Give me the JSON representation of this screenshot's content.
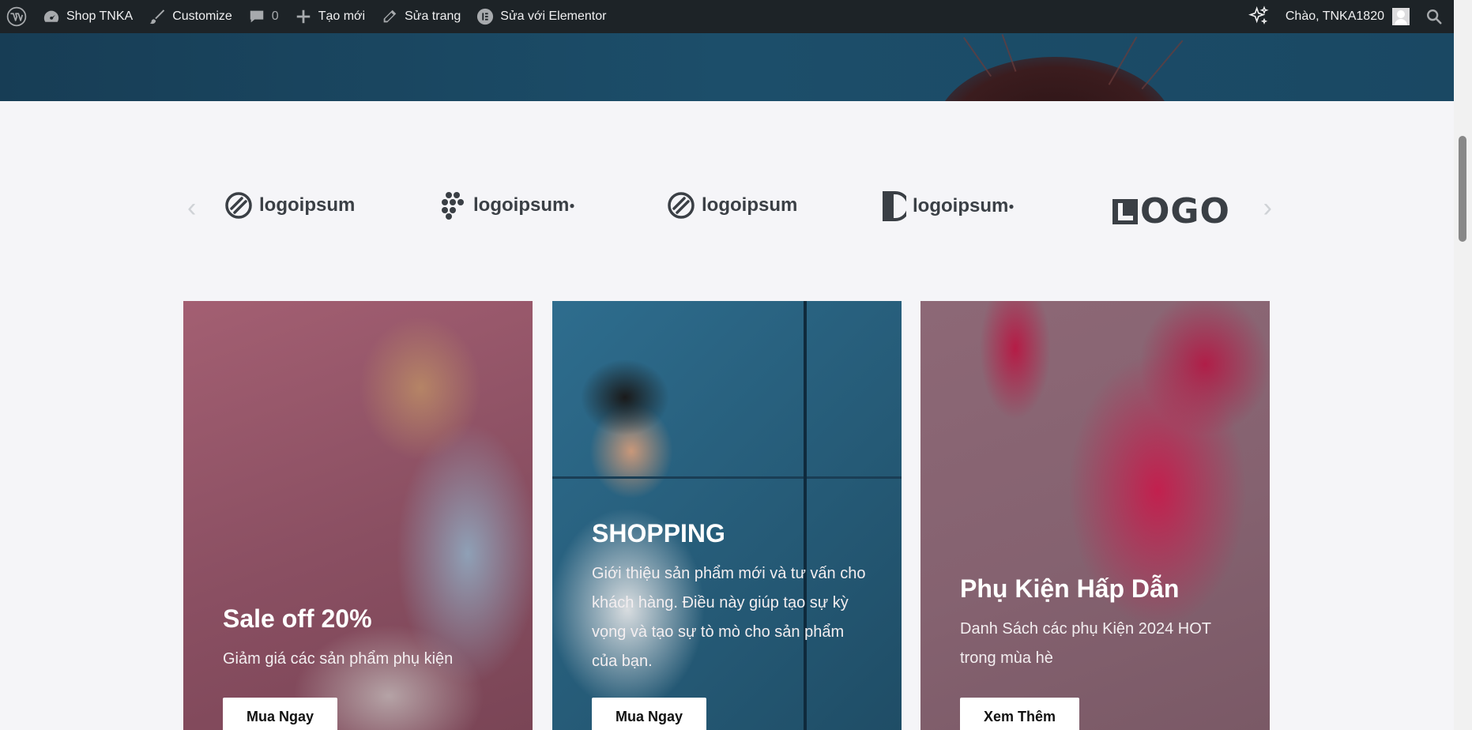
{
  "admin_bar": {
    "site_name": "Shop TNKA",
    "customize": "Customize",
    "comments_count": "0",
    "new_label": "Tạo mới",
    "edit_page": "Sửa trang",
    "edit_elementor": "Sửa với Elementor",
    "greeting": "Chào, TNKA1820"
  },
  "logos": [
    {
      "text": "logoipsum",
      "icon": "ring-stripes-icon"
    },
    {
      "text": "logoipsum",
      "icon": "dots-cluster-icon"
    },
    {
      "text": "logoipsum",
      "icon": "ring-stripes-icon"
    },
    {
      "text": "logoipsum",
      "icon": "half-circle-icon"
    },
    {
      "text": "OGO",
      "icon": "square-L-icon"
    }
  ],
  "cards": [
    {
      "title": "Sale off 20%",
      "description": "Giảm giá các sản phẩm phụ kiện",
      "button": "Mua Ngay",
      "overlay": "#8a4f62"
    },
    {
      "title": "SHOPPING",
      "description": "Giới thiệu sản phẩm mới và tư vấn cho khách hàng. Điều này giúp tạo sự kỳ vọng và tạo sự tò mò cho sản phẩm của bạn.",
      "button": "Mua Ngay",
      "overlay": "#2a5d7a"
    },
    {
      "title": "Phụ Kiện Hấp Dẫn",
      "description": "Danh Sách các phụ Kiện 2024 HOT trong mùa hè",
      "button": "Xem Thêm",
      "overlay": "#856270"
    }
  ],
  "colors": {
    "admin_bar_bg": "#1d2327",
    "page_bg": "#f5f5f8",
    "logo_text": "#3a3f45"
  }
}
